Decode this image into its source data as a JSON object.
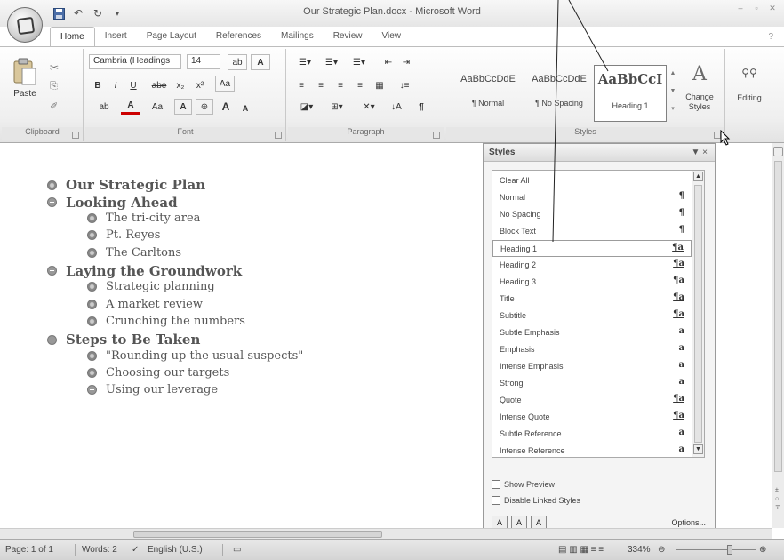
{
  "window": {
    "title": "Our Strategic Plan.docx - Microsoft Word"
  },
  "tabs": [
    "Home",
    "Insert",
    "Page Layout",
    "References",
    "Mailings",
    "Review",
    "View"
  ],
  "ribbon": {
    "clipboard": {
      "label": "Clipboard",
      "paste": "Paste"
    },
    "font": {
      "label": "Font",
      "font_name": "Cambria (Headings",
      "font_size": "14",
      "bold": "B",
      "italic": "I",
      "underline": "U",
      "strike": "abe",
      "subscript": "x₂",
      "superscript": "x²",
      "grow": "A",
      "shrink": "A",
      "case": "Aa",
      "color": "A"
    },
    "paragraph": {
      "label": "Paragraph",
      "pilcrow": "¶"
    },
    "styles": {
      "label": "Styles",
      "gallery": [
        {
          "sample": "AaBbCcDdE",
          "name": "¶ Normal"
        },
        {
          "sample": "AaBbCcDdE",
          "name": "¶ No Spacing"
        },
        {
          "sample": "AaBbCcI",
          "name": "Heading 1"
        }
      ],
      "change_styles": "Change Styles"
    },
    "editing": {
      "label": "Editing"
    }
  },
  "document": {
    "outline": [
      {
        "text": "Our Strategic Plan",
        "level": 1,
        "bullet": "minus"
      },
      {
        "text": "Looking Ahead",
        "level": 1,
        "bullet": "plus"
      },
      {
        "text": "The tri-city area",
        "level": 2,
        "bullet": "minus"
      },
      {
        "text": "Pt. Reyes",
        "level": 2,
        "bullet": "minus"
      },
      {
        "text": "The Carltons",
        "level": 2,
        "bullet": "minus"
      },
      {
        "text": "Laying the Groundwork",
        "level": 1,
        "bullet": "plus"
      },
      {
        "text": "Strategic planning",
        "level": 2,
        "bullet": "minus"
      },
      {
        "text": "A market review",
        "level": 2,
        "bullet": "minus"
      },
      {
        "text": "Crunching the numbers",
        "level": 2,
        "bullet": "minus"
      },
      {
        "text": "Steps to Be Taken",
        "level": 1,
        "bullet": "plus"
      },
      {
        "text": "\"Rounding up the usual suspects\"",
        "level": 2,
        "bullet": "minus"
      },
      {
        "text": "Choosing our targets",
        "level": 2,
        "bullet": "minus"
      },
      {
        "text": "Using our leverage",
        "level": 2,
        "bullet": "plus"
      }
    ]
  },
  "styles_pane": {
    "title": "Styles",
    "controls": "▼ ×",
    "items": [
      {
        "name": "Clear All",
        "mark": ""
      },
      {
        "name": "Normal",
        "mark": "¶"
      },
      {
        "name": "No Spacing",
        "mark": "¶"
      },
      {
        "name": "Block Text",
        "mark": "¶"
      },
      {
        "name": "Heading 1",
        "mark": "¶a",
        "selected": true
      },
      {
        "name": "Heading 2",
        "mark": "¶a"
      },
      {
        "name": "Heading 3",
        "mark": "¶a"
      },
      {
        "name": "Title",
        "mark": "¶a"
      },
      {
        "name": "Subtitle",
        "mark": "¶a"
      },
      {
        "name": "Subtle Emphasis",
        "mark": "a"
      },
      {
        "name": "Emphasis",
        "mark": "a"
      },
      {
        "name": "Intense Emphasis",
        "mark": "a"
      },
      {
        "name": "Strong",
        "mark": "a"
      },
      {
        "name": "Quote",
        "mark": "¶a"
      },
      {
        "name": "Intense Quote",
        "mark": "¶a"
      },
      {
        "name": "Subtle Reference",
        "mark": "a"
      },
      {
        "name": "Intense Reference",
        "mark": "a"
      }
    ],
    "show_preview": "Show Preview",
    "disable_linked": "Disable Linked Styles",
    "options": "Options..."
  },
  "statusbar": {
    "page": "Page: 1 of 1",
    "words": "Words: 2",
    "language": "English (U.S.)",
    "zoom": "334%"
  }
}
